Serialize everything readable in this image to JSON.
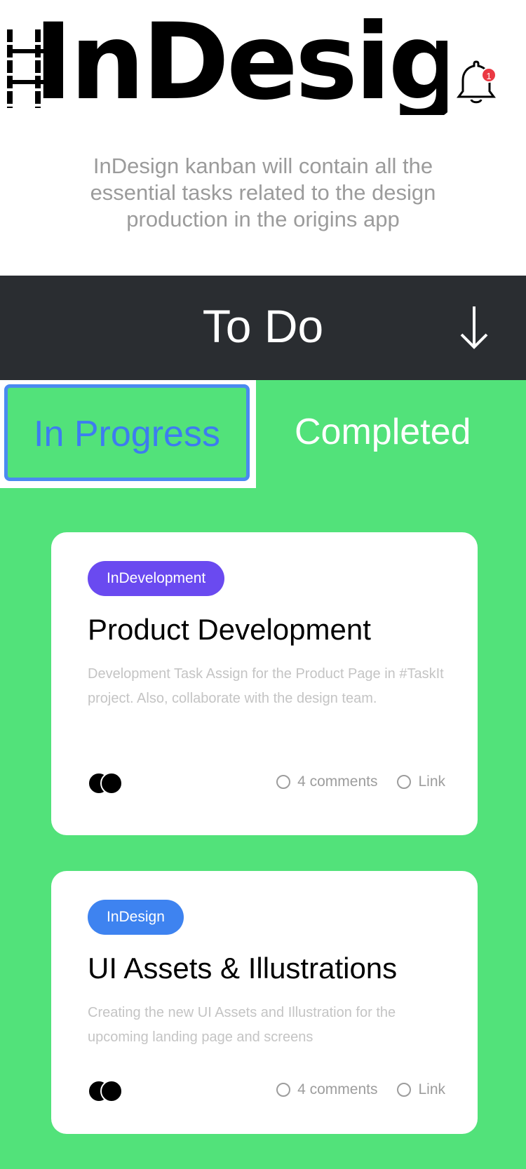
{
  "header": {
    "brand": "InDesign",
    "notification_count": "1",
    "tagline": "InDesign kanban will contain all the essential tasks related to the design production in the origins app"
  },
  "todo": {
    "label": "To Do"
  },
  "tabs": {
    "in_progress": "In Progress",
    "completed": "Completed"
  },
  "cards": [
    {
      "tag": "InDevelopment",
      "tag_color": "#6a4af0",
      "title": "Product Development",
      "description": "Development Task Assign for the Product Page in #TaskIt project. Also, collaborate with the design team.",
      "comments": "4 comments",
      "link": "Link"
    },
    {
      "tag": "InDesign",
      "tag_color": "#3e83f0",
      "title": "UI Assets & Illustrations",
      "description": "Creating the new UI Assets and Illustration for the upcoming landing page and screens",
      "comments": "4 comments",
      "link": "Link"
    }
  ],
  "colors": {
    "board": "#52e27a",
    "bar": "#2a2d31",
    "accent": "#3d7cf0",
    "badge": "#ea3943"
  }
}
